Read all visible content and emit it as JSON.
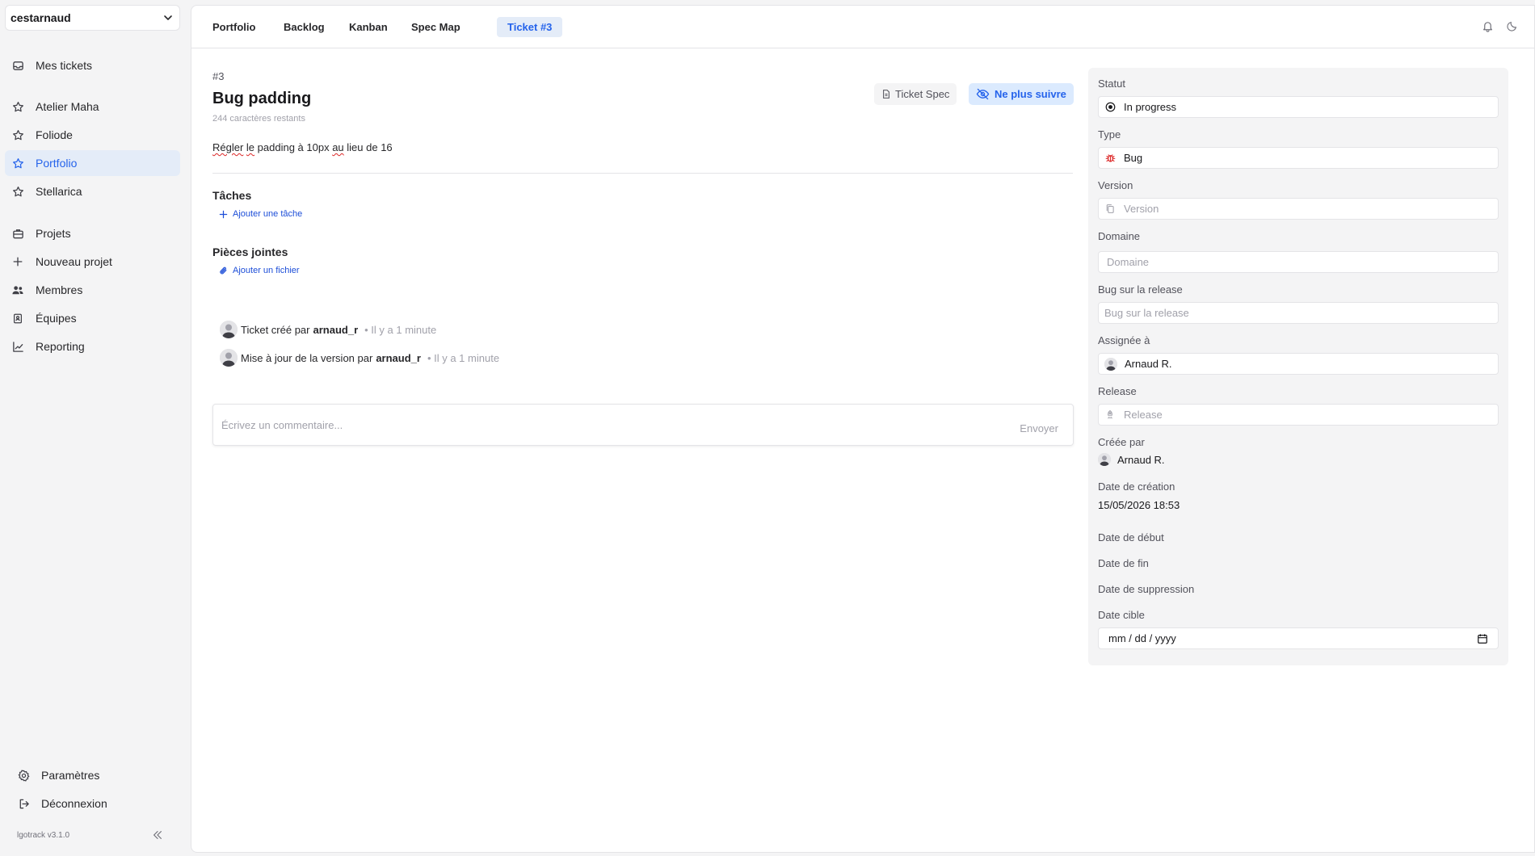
{
  "sidebar": {
    "workspace": "cestarnaud",
    "items": [
      {
        "label": "Mes tickets",
        "icon": "inbox-icon"
      },
      {
        "label": "Atelier Maha",
        "icon": "star-icon"
      },
      {
        "label": "Foliode",
        "icon": "star-icon"
      },
      {
        "label": "Portfolio",
        "icon": "star-icon",
        "active": true
      },
      {
        "label": "Stellarica",
        "icon": "star-icon"
      },
      {
        "label": "Projets",
        "icon": "briefcase-icon"
      },
      {
        "label": "Nouveau projet",
        "icon": "plus-icon"
      },
      {
        "label": "Membres",
        "icon": "users-icon"
      },
      {
        "label": "Équipes",
        "icon": "team-icon"
      },
      {
        "label": "Reporting",
        "icon": "chart-icon"
      }
    ],
    "footer": [
      {
        "label": "Paramètres",
        "icon": "gear-icon"
      },
      {
        "label": "Déconnexion",
        "icon": "logout-icon"
      }
    ],
    "version": "lgotrack v3.1.0"
  },
  "tabs": [
    {
      "label": "Portfolio"
    },
    {
      "label": "Backlog"
    },
    {
      "label": "Kanban"
    },
    {
      "label": "Spec Map"
    },
    {
      "label": "Ticket #3",
      "active": true
    }
  ],
  "ticket": {
    "number": "#3",
    "title": "Bug padding",
    "chars_left": "244 caractères restants",
    "spec_button": "Ticket Spec",
    "unfollow_button": "Ne plus suivre",
    "description": {
      "w1": "Régler",
      "w2": " ",
      "w3": "le",
      "w4": " padding à 10px ",
      "w5": "au",
      "w6": " lieu de 16"
    },
    "tasks_title": "Tâches",
    "add_task": "Ajouter une tâche",
    "attachments_title": "Pièces jointes",
    "add_file": "Ajouter un fichier",
    "activity": [
      {
        "text": "Ticket créé par",
        "user": "arnaud_r",
        "time": "• Il y a 1 minute"
      },
      {
        "text": "Mise à jour de la version par",
        "user": "arnaud_r",
        "time": "• Il y a 1 minute"
      }
    ],
    "comment_placeholder": "Écrivez un commentaire...",
    "send": "Envoyer"
  },
  "details": {
    "status": {
      "label": "Statut",
      "value": "In progress"
    },
    "type": {
      "label": "Type",
      "value": "Bug"
    },
    "version": {
      "label": "Version",
      "placeholder": "Version"
    },
    "domain": {
      "label": "Domaine",
      "placeholder": "Domaine"
    },
    "bug_release": {
      "label": "Bug sur la release",
      "placeholder": "Bug sur la release"
    },
    "assignee": {
      "label": "Assignée à",
      "value": "Arnaud R."
    },
    "release": {
      "label": "Release",
      "placeholder": "Release"
    },
    "created_by": {
      "label": "Créée par",
      "value": "Arnaud R."
    },
    "created_at": {
      "label": "Date de création",
      "value": "15/05/2026 18:53"
    },
    "start_date": {
      "label": "Date de début"
    },
    "end_date": {
      "label": "Date de fin"
    },
    "deletion_date": {
      "label": "Date de suppression"
    },
    "target_date": {
      "label": "Date cible",
      "placeholder": "mm / dd / yyyy"
    }
  },
  "colors": {
    "accent": "#2563eb",
    "accent_bg": "#e4ecf8",
    "bug": "#dc2626"
  }
}
